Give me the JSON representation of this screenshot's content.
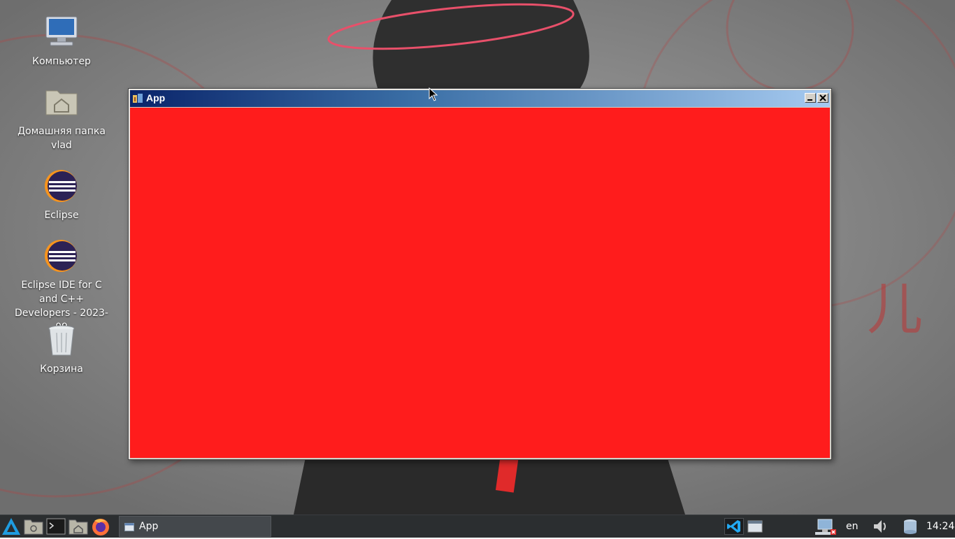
{
  "desktop": {
    "icons": [
      {
        "label": "Компьютер"
      },
      {
        "label": "Домашняя папка vlad"
      },
      {
        "label": "Eclipse"
      },
      {
        "label": "Eclipse IDE for C and C++ Developers - 2023-09"
      },
      {
        "label": "Корзина"
      }
    ]
  },
  "window": {
    "title": "App",
    "icon": "java-app-icon",
    "content_color": "#ff1c1c",
    "controls": [
      "minimize-icon",
      "close-icon"
    ]
  },
  "taskbar": {
    "launchers": [
      "app-menu-icon",
      "file-manager-icon",
      "terminal-icon",
      "home-folder-icon",
      "firefox-icon"
    ],
    "tasks": [
      {
        "label": "App",
        "icon": "window-icon"
      }
    ],
    "tray": {
      "apps": [
        "vscode-icon",
        "window-switcher-icon"
      ],
      "network": "network-disconnected-icon",
      "language": "en",
      "volume": "volume-icon",
      "storage": "storage-icon",
      "clock": "14:24"
    }
  }
}
